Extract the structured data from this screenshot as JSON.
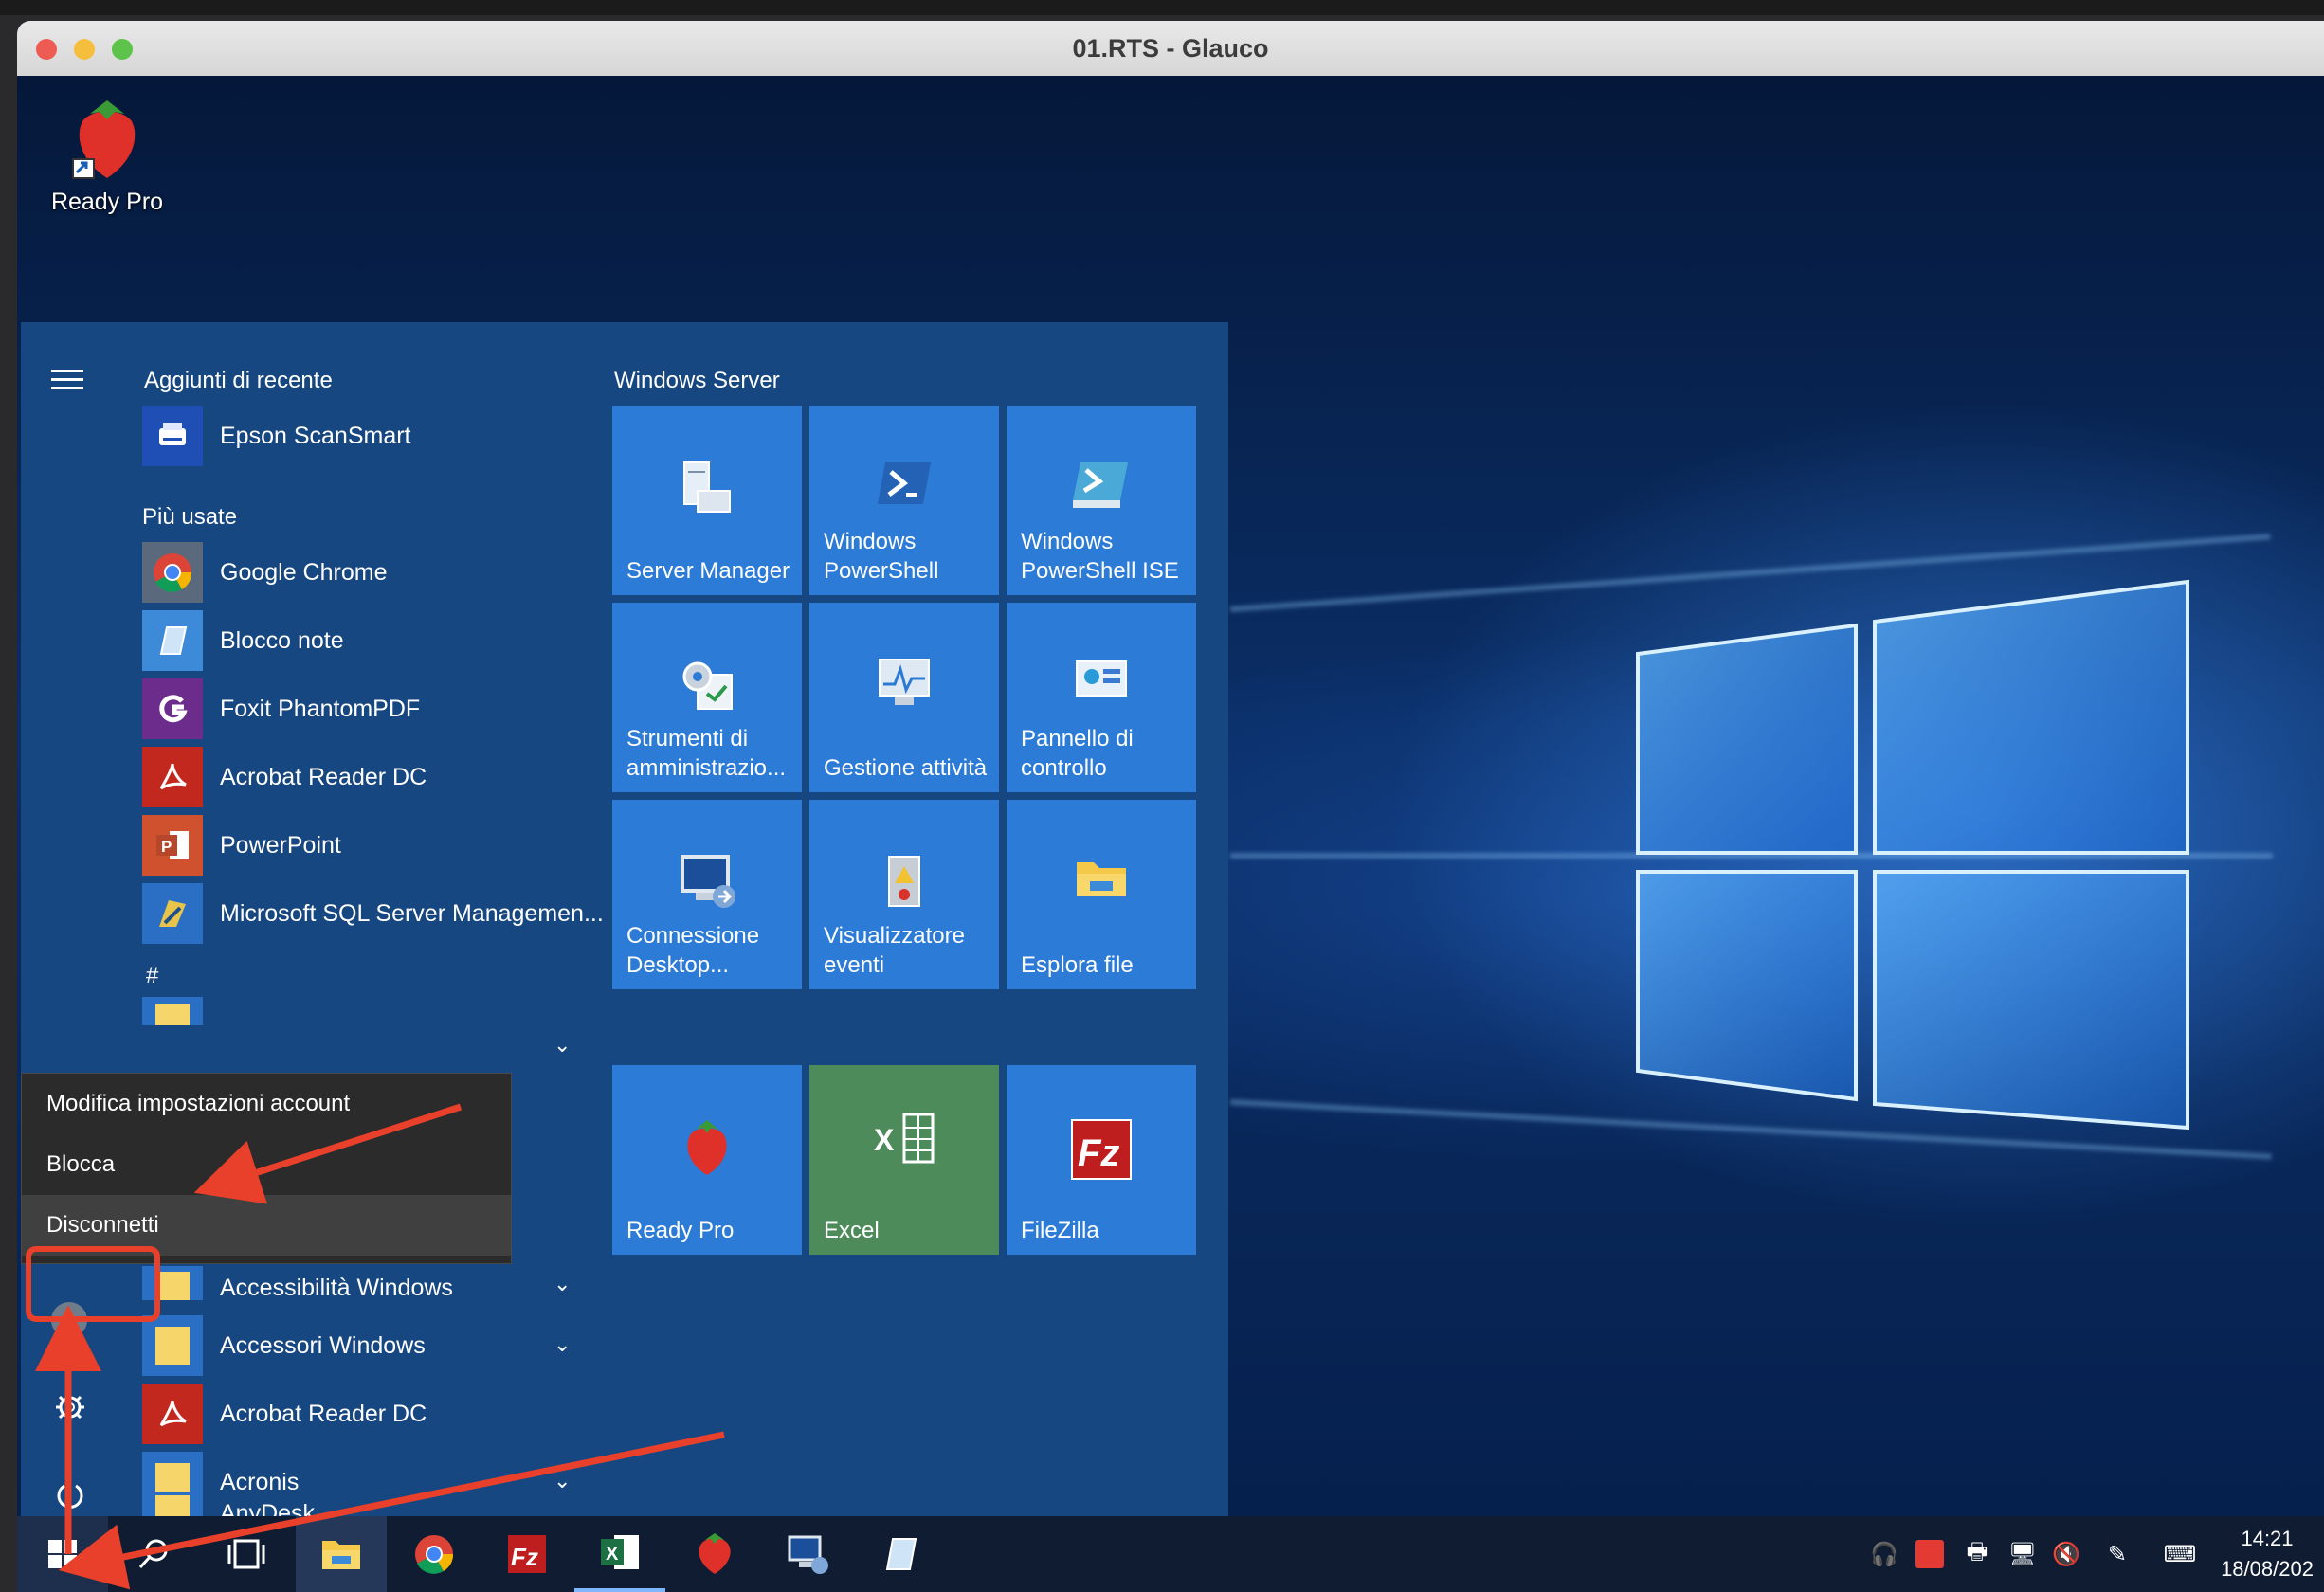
{
  "window": {
    "title": "01.RTS - Glauco"
  },
  "desktop": {
    "shortcut_label": "Ready Pro"
  },
  "start_menu": {
    "recent_header": "Aggiunti di recente",
    "recent_items": [
      {
        "label": "Epson ScanSmart",
        "icon": "scanner-icon"
      }
    ],
    "most_used_header": "Più usate",
    "most_used_items": [
      {
        "label": "Google Chrome",
        "icon": "chrome-icon"
      },
      {
        "label": "Blocco note",
        "icon": "notepad-icon"
      },
      {
        "label": "Foxit PhantomPDF",
        "icon": "foxit-icon"
      },
      {
        "label": "Acrobat Reader DC",
        "icon": "acrobat-icon"
      },
      {
        "label": "PowerPoint",
        "icon": "powerpoint-icon"
      },
      {
        "label": "Microsoft SQL Server Managemen...",
        "icon": "sql-server-icon"
      }
    ],
    "hash_header": "#",
    "all_apps": [
      {
        "label": "Accessibilità Windows",
        "icon": "folder-icon",
        "expandable": true
      },
      {
        "label": "Accessori Windows",
        "icon": "folder-icon",
        "expandable": true
      },
      {
        "label": "Acrobat Reader DC",
        "icon": "acrobat-icon",
        "expandable": false
      },
      {
        "label": "Acronis",
        "icon": "folder-icon",
        "expandable": true
      },
      {
        "label": "AnyDesk",
        "icon": "folder-icon",
        "expandable": true
      }
    ],
    "tiles_header": "Windows Server",
    "tiles": [
      {
        "label": "Server Manager",
        "icon": "server-manager-icon"
      },
      {
        "label": "Windows PowerShell",
        "icon": "powershell-icon"
      },
      {
        "label": "Windows PowerShell ISE",
        "icon": "powershell-ise-icon"
      },
      {
        "label": "Strumenti di amministrazio...",
        "icon": "admin-tools-icon"
      },
      {
        "label": "Gestione attività",
        "icon": "task-manager-icon"
      },
      {
        "label": "Pannello di controllo",
        "icon": "control-panel-icon"
      },
      {
        "label": "Connessione Desktop...",
        "icon": "remote-desktop-icon"
      },
      {
        "label": "Visualizzatore eventi",
        "icon": "event-viewer-icon"
      },
      {
        "label": "Esplora file",
        "icon": "file-explorer-icon"
      },
      {
        "label": "Ready Pro",
        "icon": "ready-pro-icon"
      },
      {
        "label": "Excel",
        "icon": "excel-icon"
      },
      {
        "label": "FileZilla",
        "icon": "filezilla-icon"
      }
    ]
  },
  "context_menu": {
    "items": [
      "Modifica impostazioni account",
      "Blocca",
      "Disconnetti"
    ]
  },
  "taskbar": {
    "apps": [
      "start-icon",
      "search-icon",
      "task-view-icon",
      "file-explorer-icon",
      "chrome-icon",
      "filezilla-icon",
      "excel-icon",
      "ready-pro-icon",
      "remote-desktop-icon",
      "notepad-icon"
    ],
    "time": "14:21",
    "date": "18/08/202"
  },
  "colors": {
    "accent": "#2c7bd6",
    "excel_tile": "#4e8b5a",
    "annotation": "#e8402a"
  }
}
